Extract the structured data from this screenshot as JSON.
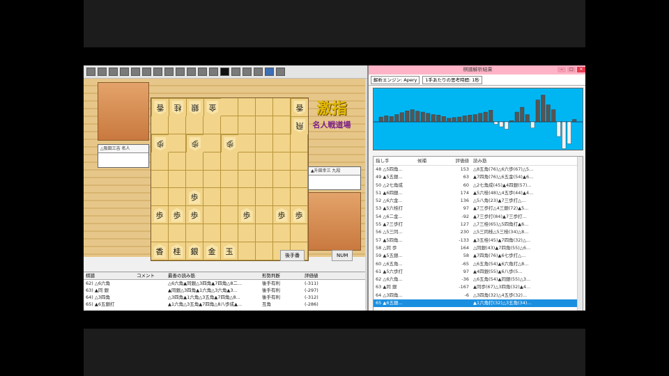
{
  "board": [
    [
      "香",
      "桂",
      "銀",
      "金",
      "",
      "",
      "",
      "",
      "香"
    ],
    [
      "",
      "",
      "",
      "",
      "",
      "",
      "",
      "",
      "飛"
    ],
    [
      "歩",
      "",
      "歩",
      "",
      "歩",
      "",
      "",
      "",
      ""
    ],
    [
      "",
      "",
      "",
      "",
      "",
      "",
      "",
      "",
      ""
    ],
    [
      "",
      "",
      "",
      "",
      "",
      "",
      "",
      "",
      ""
    ],
    [
      "",
      "",
      "歩",
      "",
      "",
      "",
      "",
      "",
      ""
    ],
    [
      "歩",
      "歩",
      "歩",
      "",
      "",
      "歩",
      "",
      "歩",
      "歩"
    ],
    [
      "",
      "",
      "",
      "",
      "",
      "",
      "",
      "",
      ""
    ],
    [
      "香",
      "桂",
      "銀",
      "金",
      "玉",
      "",
      "",
      "",
      ""
    ]
  ],
  "board_ai": [
    [
      true,
      true,
      true,
      true,
      false,
      false,
      false,
      false,
      true
    ],
    [
      false,
      false,
      false,
      false,
      false,
      false,
      false,
      false,
      true
    ],
    [
      true,
      false,
      true,
      false,
      true,
      false,
      false,
      false,
      false
    ],
    [
      false,
      false,
      false,
      false,
      false,
      false,
      false,
      false,
      false
    ],
    [
      false,
      false,
      false,
      false,
      false,
      false,
      false,
      false,
      false
    ],
    [
      false,
      false,
      false,
      false,
      false,
      false,
      false,
      false,
      false
    ],
    [
      false,
      false,
      false,
      false,
      false,
      false,
      false,
      false,
      false
    ],
    [
      false,
      false,
      false,
      false,
      false,
      false,
      false,
      false,
      false
    ],
    [
      false,
      false,
      false,
      false,
      false,
      false,
      false,
      false,
      false
    ]
  ],
  "left_app": {
    "player_top": "△阪田三吉 名人",
    "player_bottom": "▲升田幸三 九段",
    "logo_main": "激指",
    "logo_sub": "名人戦道場",
    "status_turn": "後手番",
    "status_num": "NUM",
    "grid_headers": [
      "棋譜",
      "コメント",
      "最善の読み筋",
      "形勢判断",
      "評価値"
    ],
    "grid_rows": [
      [
        "62) △6六角",
        "",
        "△6六角▲同銀△3四角▲7四角△8二...",
        "後手有利",
        "(-311)"
      ],
      [
        "63) ▲同 銀",
        "",
        "▲同銀△3四角▲1六角△3六角▲3...",
        "後手有利",
        "(-297)"
      ],
      [
        "64) △3四角",
        "",
        "△3四角▲1六角△3五角▲7四角△8...",
        "後手有利",
        "(-312)"
      ],
      [
        "65) ▲6五銀打",
        "",
        "▲1六角△3五角▲7四角△8八歩成▲...",
        "互角",
        "(-286)"
      ]
    ]
  },
  "analysis": {
    "title": "棋譜解析結果",
    "engine_label": "解析エンジン: Apery",
    "time_label": "1手あたりの思考時間: 1秒",
    "headers": [
      "指し手",
      "候補",
      "評価値",
      "読み筋"
    ],
    "rows": [
      [
        "48 △5四角...",
        "",
        "153",
        "△8五角(76)△6六歩(67)△5..."
      ],
      [
        "49 ▲5五銀...",
        "",
        "63",
        "▲7四角(76)△6五金(54)▲6..."
      ],
      [
        "50 △2七角成",
        "",
        "60",
        "△2七角成(45)▲4四銀(57)..."
      ],
      [
        "51 ▲6四銀...",
        "",
        "174",
        "▲5六桂(48)△4五歩(44)▲4..."
      ],
      [
        "52 △6六金...",
        "",
        "136",
        "△5八角(23)▲7三歩打△..."
      ],
      [
        "53 ▲5六桂打",
        "",
        "97",
        "▲7三歩打△4三銀(72)▲5..."
      ],
      [
        "54 △6二金...",
        "",
        "-92",
        "▲7三歩打(84)▲7三歩打..."
      ],
      [
        "55 ▲7三歩打",
        "",
        "127",
        "△7三桂(65)△5四角打▲6..."
      ],
      [
        "56 △5三同...",
        "",
        "230",
        "△5三同桂△5三桂(34)△8..."
      ],
      [
        "57 ▲5四角...",
        "",
        "-133",
        "▲3五桂(45)▲7四角(32)△..."
      ],
      [
        "58 △同 歩",
        "",
        "164",
        "△同銀(43)▲7四角(55)△6..."
      ],
      [
        "59 ▲5五銀...",
        "",
        "58",
        "▲7四角(76)▲6七歩打△..."
      ],
      [
        "60 △6五角...",
        "",
        "-65",
        "△6五角(54)▲6六角打△8..."
      ],
      [
        "61 ▲5六歩打",
        "",
        "97",
        "▲4四銀(55)▲6八歩(5..."
      ],
      [
        "62 △6六角...",
        "",
        "-36",
        "△6五角(54)▲同銀(55)△3..."
      ],
      [
        "63 ▲同 銀",
        "",
        "-167",
        "▲同歩(67)△3四角(32)▲4..."
      ],
      [
        "64 △3四角...",
        "",
        "-6",
        "△3四角(32)△4五歩(32)..."
      ],
      [
        "65 ▲6五銀...",
        "",
        "",
        "▲1六角打(32)△3五角(34)..."
      ]
    ],
    "selected_row": 17,
    "graph_values": [
      20,
      25,
      22,
      30,
      38,
      45,
      50,
      44,
      40,
      35,
      30,
      28,
      22,
      15,
      18,
      20,
      25,
      28,
      30,
      35,
      40,
      48,
      -10,
      -20,
      -30,
      5,
      40,
      60,
      30,
      -25,
      90,
      110,
      70,
      50,
      -60,
      -110,
      -90,
      10
    ]
  }
}
